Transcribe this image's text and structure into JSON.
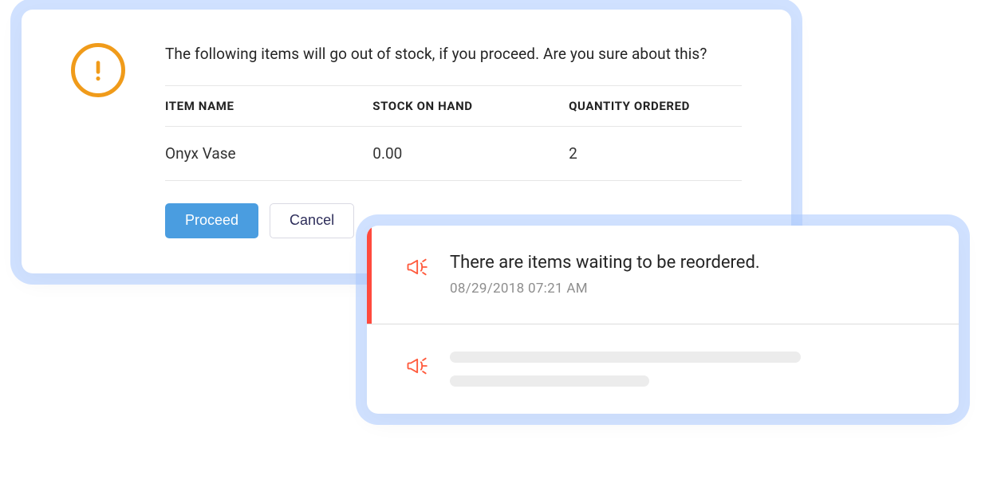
{
  "dialog": {
    "message": "The following items will go out of stock, if you proceed. Are you sure about this?",
    "columns": {
      "name": "Item Name",
      "stock": "Stock on Hand",
      "qty": "Quantity Ordered"
    },
    "rows": [
      {
        "name": "Onyx Vase",
        "stock": "0.00",
        "qty": "2"
      }
    ],
    "actions": {
      "proceed": "Proceed",
      "cancel": "Cancel"
    }
  },
  "notifications": [
    {
      "title": "There are items waiting to be reordered.",
      "timestamp": "08/29/2018  07:21 AM"
    }
  ]
}
